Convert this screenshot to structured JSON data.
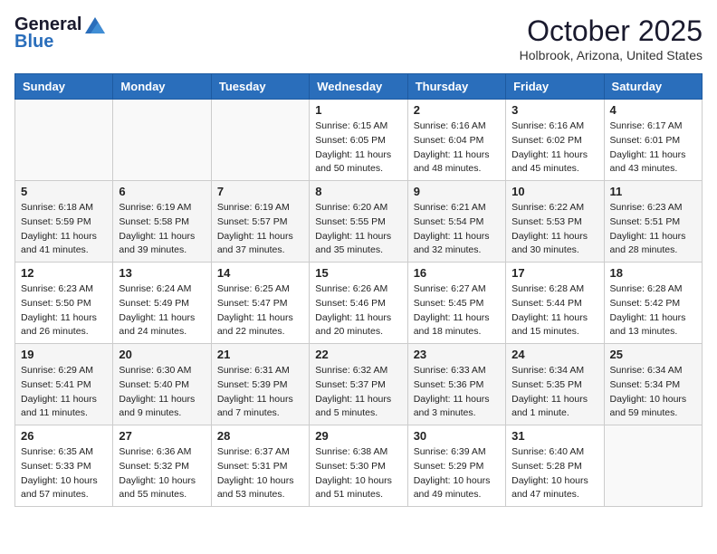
{
  "logo": {
    "general": "General",
    "blue": "Blue"
  },
  "title": "October 2025",
  "location": "Holbrook, Arizona, United States",
  "days_of_week": [
    "Sunday",
    "Monday",
    "Tuesday",
    "Wednesday",
    "Thursday",
    "Friday",
    "Saturday"
  ],
  "weeks": [
    [
      {
        "day": "",
        "info": ""
      },
      {
        "day": "",
        "info": ""
      },
      {
        "day": "",
        "info": ""
      },
      {
        "day": "1",
        "info": "Sunrise: 6:15 AM\nSunset: 6:05 PM\nDaylight: 11 hours\nand 50 minutes."
      },
      {
        "day": "2",
        "info": "Sunrise: 6:16 AM\nSunset: 6:04 PM\nDaylight: 11 hours\nand 48 minutes."
      },
      {
        "day": "3",
        "info": "Sunrise: 6:16 AM\nSunset: 6:02 PM\nDaylight: 11 hours\nand 45 minutes."
      },
      {
        "day": "4",
        "info": "Sunrise: 6:17 AM\nSunset: 6:01 PM\nDaylight: 11 hours\nand 43 minutes."
      }
    ],
    [
      {
        "day": "5",
        "info": "Sunrise: 6:18 AM\nSunset: 5:59 PM\nDaylight: 11 hours\nand 41 minutes."
      },
      {
        "day": "6",
        "info": "Sunrise: 6:19 AM\nSunset: 5:58 PM\nDaylight: 11 hours\nand 39 minutes."
      },
      {
        "day": "7",
        "info": "Sunrise: 6:19 AM\nSunset: 5:57 PM\nDaylight: 11 hours\nand 37 minutes."
      },
      {
        "day": "8",
        "info": "Sunrise: 6:20 AM\nSunset: 5:55 PM\nDaylight: 11 hours\nand 35 minutes."
      },
      {
        "day": "9",
        "info": "Sunrise: 6:21 AM\nSunset: 5:54 PM\nDaylight: 11 hours\nand 32 minutes."
      },
      {
        "day": "10",
        "info": "Sunrise: 6:22 AM\nSunset: 5:53 PM\nDaylight: 11 hours\nand 30 minutes."
      },
      {
        "day": "11",
        "info": "Sunrise: 6:23 AM\nSunset: 5:51 PM\nDaylight: 11 hours\nand 28 minutes."
      }
    ],
    [
      {
        "day": "12",
        "info": "Sunrise: 6:23 AM\nSunset: 5:50 PM\nDaylight: 11 hours\nand 26 minutes."
      },
      {
        "day": "13",
        "info": "Sunrise: 6:24 AM\nSunset: 5:49 PM\nDaylight: 11 hours\nand 24 minutes."
      },
      {
        "day": "14",
        "info": "Sunrise: 6:25 AM\nSunset: 5:47 PM\nDaylight: 11 hours\nand 22 minutes."
      },
      {
        "day": "15",
        "info": "Sunrise: 6:26 AM\nSunset: 5:46 PM\nDaylight: 11 hours\nand 20 minutes."
      },
      {
        "day": "16",
        "info": "Sunrise: 6:27 AM\nSunset: 5:45 PM\nDaylight: 11 hours\nand 18 minutes."
      },
      {
        "day": "17",
        "info": "Sunrise: 6:28 AM\nSunset: 5:44 PM\nDaylight: 11 hours\nand 15 minutes."
      },
      {
        "day": "18",
        "info": "Sunrise: 6:28 AM\nSunset: 5:42 PM\nDaylight: 11 hours\nand 13 minutes."
      }
    ],
    [
      {
        "day": "19",
        "info": "Sunrise: 6:29 AM\nSunset: 5:41 PM\nDaylight: 11 hours\nand 11 minutes."
      },
      {
        "day": "20",
        "info": "Sunrise: 6:30 AM\nSunset: 5:40 PM\nDaylight: 11 hours\nand 9 minutes."
      },
      {
        "day": "21",
        "info": "Sunrise: 6:31 AM\nSunset: 5:39 PM\nDaylight: 11 hours\nand 7 minutes."
      },
      {
        "day": "22",
        "info": "Sunrise: 6:32 AM\nSunset: 5:37 PM\nDaylight: 11 hours\nand 5 minutes."
      },
      {
        "day": "23",
        "info": "Sunrise: 6:33 AM\nSunset: 5:36 PM\nDaylight: 11 hours\nand 3 minutes."
      },
      {
        "day": "24",
        "info": "Sunrise: 6:34 AM\nSunset: 5:35 PM\nDaylight: 11 hours\nand 1 minute."
      },
      {
        "day": "25",
        "info": "Sunrise: 6:34 AM\nSunset: 5:34 PM\nDaylight: 10 hours\nand 59 minutes."
      }
    ],
    [
      {
        "day": "26",
        "info": "Sunrise: 6:35 AM\nSunset: 5:33 PM\nDaylight: 10 hours\nand 57 minutes."
      },
      {
        "day": "27",
        "info": "Sunrise: 6:36 AM\nSunset: 5:32 PM\nDaylight: 10 hours\nand 55 minutes."
      },
      {
        "day": "28",
        "info": "Sunrise: 6:37 AM\nSunset: 5:31 PM\nDaylight: 10 hours\nand 53 minutes."
      },
      {
        "day": "29",
        "info": "Sunrise: 6:38 AM\nSunset: 5:30 PM\nDaylight: 10 hours\nand 51 minutes."
      },
      {
        "day": "30",
        "info": "Sunrise: 6:39 AM\nSunset: 5:29 PM\nDaylight: 10 hours\nand 49 minutes."
      },
      {
        "day": "31",
        "info": "Sunrise: 6:40 AM\nSunset: 5:28 PM\nDaylight: 10 hours\nand 47 minutes."
      },
      {
        "day": "",
        "info": ""
      }
    ]
  ]
}
